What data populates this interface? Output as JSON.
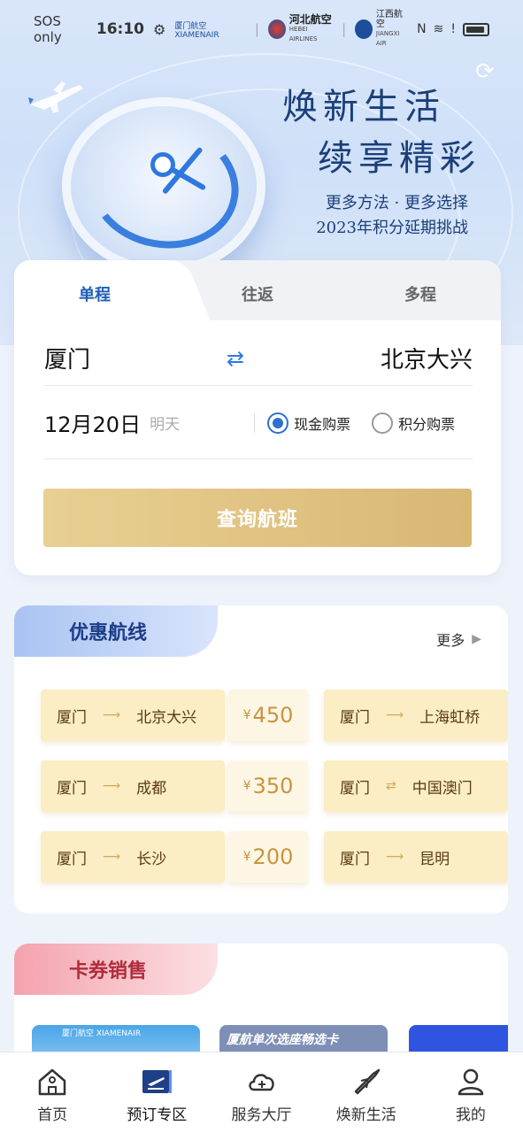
{
  "status_bar": {
    "carrier": "SOS only",
    "time": "16:10",
    "airline1": "厦门航空 XIAMENAIR",
    "airline2": "河北航空",
    "airline2_sub": "HEBEI AIRLINES",
    "airline3": "江西航空",
    "airline3_sub": "JIANGXI AIR"
  },
  "hero": {
    "title_line1": "焕新生活",
    "title_line2": "续享精彩",
    "sub_line1": "更多方法 · 更多选择",
    "sub_line2": "2023年积分延期挑战"
  },
  "booking": {
    "tabs": [
      "单程",
      "往返",
      "多程"
    ],
    "active_tab": "单程",
    "from_city": "厦门",
    "to_city": "北京大兴",
    "date": "12月20日",
    "day_label": "明天",
    "pay_options": [
      "现金购票",
      "积分购票"
    ],
    "selected_pay": "现金购票",
    "search_button": "查询航班"
  },
  "promo": {
    "title": "优惠航线",
    "more": "更多",
    "routes": [
      {
        "from": "厦门",
        "to": "北京大兴",
        "price": "450"
      },
      {
        "from": "厦门",
        "to": "上海虹桥"
      },
      {
        "from": "厦门",
        "to": "成都",
        "price": "350"
      },
      {
        "from": "厦门",
        "to": "中国澳门"
      },
      {
        "from": "厦门",
        "to": "长沙",
        "price": "200"
      },
      {
        "from": "厦门",
        "to": "昆明"
      }
    ],
    "currency": "¥"
  },
  "cards": {
    "title": "卡券销售",
    "thumb2_text": "厦航单次选座畅选卡"
  },
  "nav": [
    {
      "label": "首页",
      "icon": "home-icon"
    },
    {
      "label": "预订专区",
      "icon": "booking-icon"
    },
    {
      "label": "服务大厅",
      "icon": "cloud-service-icon"
    },
    {
      "label": "焕新生活",
      "icon": "plane-tag-icon"
    },
    {
      "label": "我的",
      "icon": "user-icon"
    }
  ],
  "colors": {
    "accent": "#2f6fd0",
    "gold": "#d9b774",
    "promo_head": "#a9c3f2",
    "cards_head": "#f4a3ae"
  }
}
